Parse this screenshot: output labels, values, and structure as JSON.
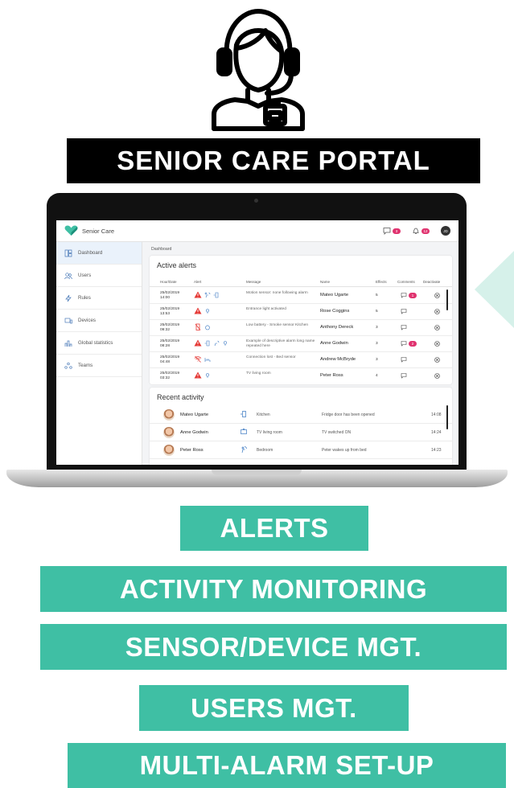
{
  "banner": {
    "title": "SENIOR CARE PORTAL"
  },
  "icons": {
    "hero": "operator-headset-icon",
    "logo": "heart-logo-icon",
    "comment": "chat-bubble-icon",
    "alarm": "alarm-bell-icon",
    "alert": "warning-triangle-icon"
  },
  "colors": {
    "accent": "#3fbfa4",
    "banner_bg": "#000000",
    "badge": "#e0336f",
    "alert_red": "#e53935"
  },
  "app": {
    "name": "Senior Care",
    "header": {
      "messages_count": "3",
      "alarms_count": "12",
      "user_initials": "JD"
    },
    "sidebar": [
      {
        "label": "Dashboard",
        "icon": "dashboard-icon",
        "active": true
      },
      {
        "label": "Users",
        "icon": "users-icon"
      },
      {
        "label": "Rules",
        "icon": "rules-icon"
      },
      {
        "label": "Devices",
        "icon": "devices-icon"
      },
      {
        "label": "Global statistics",
        "icon": "statistics-icon"
      },
      {
        "label": "Teams",
        "icon": "teams-icon"
      }
    ],
    "breadcrumb": "Dashboard",
    "alerts": {
      "title": "Active alerts",
      "columns": [
        "Hour/Date",
        "Alert",
        "Message",
        "Name",
        "Effects",
        "Comments",
        "Deactivate"
      ],
      "rows": [
        {
          "date": "25/02/2019",
          "time": "14:00",
          "message": "Motion sensor: none following alarm",
          "name": "Mateo Ugarte",
          "effects": "5",
          "comments_badge": "1"
        },
        {
          "date": "25/02/2019",
          "time": "13:53",
          "message": "Entrance light activated",
          "name": "Rose Coggins",
          "effects": "5",
          "comments_badge": ""
        },
        {
          "date": "25/02/2019",
          "time": "09:32",
          "message": "Low battery - Smoke sensor Kitchen",
          "name": "Anthony Dereck",
          "effects": "3",
          "comments_badge": ""
        },
        {
          "date": "25/02/2019",
          "time": "08:28",
          "message": "Example of descriptive alarm long name repeated here",
          "name": "Anne Godwin",
          "effects": "3",
          "comments_badge": "2"
        },
        {
          "date": "25/02/2019",
          "time": "04:48",
          "message": "Connection lost - Bed sensor",
          "name": "Andrew McBryde",
          "effects": "3",
          "comments_badge": ""
        },
        {
          "date": "25/02/2019",
          "time": "03:32",
          "message": "TV living room",
          "name": "Peter Ross",
          "effects": "4",
          "comments_badge": ""
        }
      ]
    },
    "activity": {
      "title": "Recent activity",
      "rows": [
        {
          "name": "Mateo Ugarte",
          "room": "Kitchen",
          "description": "Fridge door has been opened",
          "time": "14:08"
        },
        {
          "name": "Anne Godwin",
          "room": "TV living room",
          "description": "TV switched ON",
          "time": "14:24"
        },
        {
          "name": "Peter Ross",
          "room": "Bedroom",
          "description": "Peter wakes up from bed",
          "time": "14:23"
        }
      ]
    }
  },
  "features": [
    "ALERTS",
    "ACTIVITY MONITORING",
    "SENSOR/DEVICE MGT.",
    "USERS MGT.",
    "MULTI-ALARM SET-UP"
  ]
}
